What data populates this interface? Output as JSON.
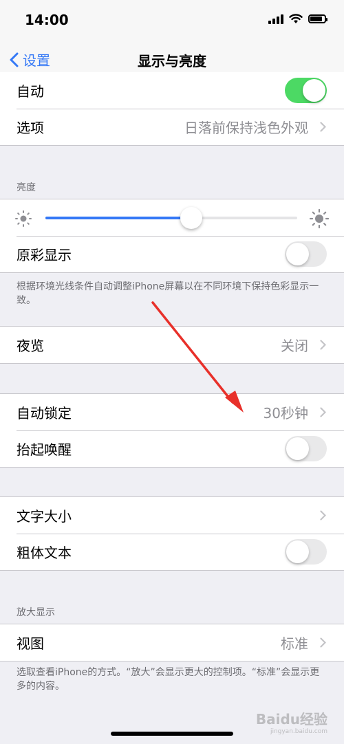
{
  "status_bar": {
    "time": "14:00"
  },
  "nav": {
    "back_label": "设置",
    "title": "显示与亮度"
  },
  "appearance": {
    "auto_label": "自动",
    "auto_on": true,
    "options_label": "选项",
    "options_value": "日落前保持浅色外观"
  },
  "brightness": {
    "header": "亮度",
    "level_percent": 58,
    "true_tone_label": "原彩显示",
    "true_tone_on": false,
    "footer": "根据环境光线条件自动调整iPhone屏幕以在不同环境下保持色彩显示一致。"
  },
  "night_shift": {
    "label": "夜览",
    "value": "关闭"
  },
  "lock": {
    "auto_lock_label": "自动锁定",
    "auto_lock_value": "30秒钟",
    "raise_to_wake_label": "抬起唤醒",
    "raise_to_wake_on": false
  },
  "text": {
    "text_size_label": "文字大小",
    "bold_text_label": "粗体文本",
    "bold_text_on": false
  },
  "zoom": {
    "header": "放大显示",
    "view_label": "视图",
    "view_value": "标准",
    "footer": "选取查看iPhone的方式。“放大”会显示更大的控制项。“标准”会显示更多的内容。"
  },
  "watermark": {
    "brand": "Baidu经验",
    "url": "jingyan.baidu.com"
  },
  "colors": {
    "accent": "#3478f6",
    "toggle_on": "#4cd964",
    "annotation_arrow": "#e8302a"
  }
}
